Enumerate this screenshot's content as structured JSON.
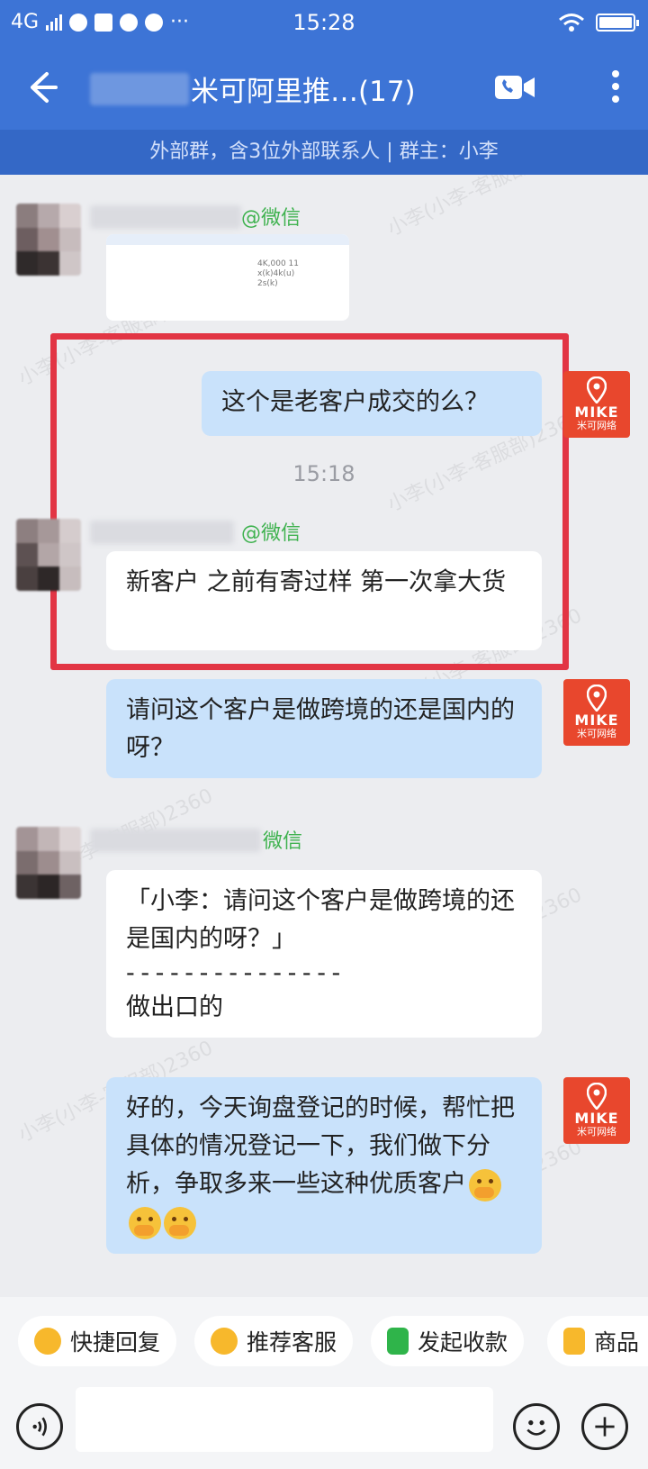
{
  "status_bar": {
    "network": "4G",
    "time": "15:28"
  },
  "header": {
    "title": "米可阿里推…(17)",
    "back_icon": "arrow-left-icon",
    "video_icon": "video-call-icon",
    "more_icon": "more-vertical-icon"
  },
  "group_info": "外部群，含3位外部联系人 | 群主：小李",
  "watermark": "小李(小李-客服部)2360",
  "messages": [
    {
      "id": 1,
      "direction": "in",
      "source": "@微信",
      "type": "image",
      "image_text": [
        "4K,000 11",
        "x(k)4k(u)",
        "2s(k)"
      ]
    },
    {
      "id": 2,
      "direction": "out",
      "text": "这个是老客户成交的么？"
    },
    {
      "id": 3,
      "type": "time",
      "text": "15:18"
    },
    {
      "id": 4,
      "direction": "in",
      "source": "@微信",
      "text": "新客户 之前有寄过样 第一次拿大货"
    },
    {
      "id": 5,
      "direction": "out",
      "text": "请问这个客户是做跨境的还是国内的呀？"
    },
    {
      "id": 6,
      "direction": "in",
      "source": "微信",
      "quote": "「小李：请问这个客户是做跨境的还是国内的呀？」",
      "divider": "- - - - - - - - - - - - - - -",
      "text": "做出口的"
    },
    {
      "id": 7,
      "direction": "out",
      "text": "好的，今天询盘登记的时候，帮忙把具体的情况登记一下，我们做下分析，争取多来一些这种优质客户"
    }
  ],
  "agent_avatar": {
    "brand": "MIKE",
    "sub": "米可网络",
    "color": "#e8472d"
  },
  "quick_actions": [
    {
      "label": "快捷回复",
      "icon": "quick-reply-icon",
      "color": "#f7b82c"
    },
    {
      "label": "推荐客服",
      "icon": "recommend-service-icon",
      "color": "#f7b82c"
    },
    {
      "label": "发起收款",
      "icon": "payment-icon",
      "color": "#2fb44a"
    },
    {
      "label": "商品",
      "icon": "product-icon",
      "color": "#f7b82c"
    }
  ],
  "input": {
    "placeholder": ""
  },
  "colors": {
    "header": "#3d74d6",
    "subbar": "#3468c6",
    "highlight": "#e23544",
    "outgoing_bubble": "#c9e2fb",
    "wechat_green": "#3fb24f"
  }
}
